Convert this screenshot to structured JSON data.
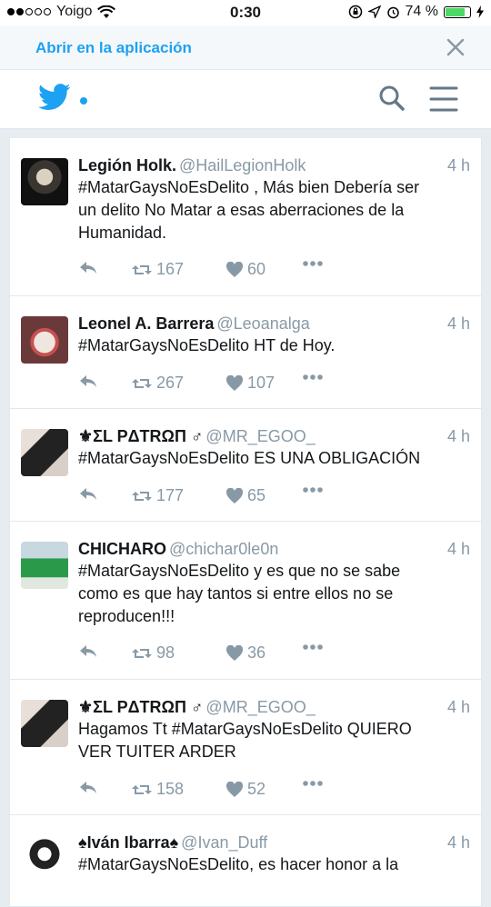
{
  "status_bar": {
    "carrier": "Yoigo",
    "time": "0:30",
    "battery": "74 %",
    "battery_level": 0.74
  },
  "banner": {
    "open_in_app": "Abrir en la aplicación"
  },
  "icons": {
    "logo": "twitter-bird-icon",
    "search": "search-icon",
    "menu": "hamburger-menu-icon",
    "close": "close-icon"
  },
  "colors": {
    "accent": "#1da1f2",
    "muted": "#8899a6",
    "background": "#e6ecf0",
    "border": "#e1e8ed"
  },
  "tweets": [
    {
      "name": "Legión Holk.",
      "handle": "@HailLegionHolk",
      "time": "4 h",
      "lines": [
        "#MatarGaysNoEsDelito , Más bien Debería ser",
        "un delito No Matar a esas aberraciones de la",
        "Humanidad."
      ],
      "retweets": "167",
      "likes": "60"
    },
    {
      "name": "Leonel A. Barrera",
      "handle": "@Leoanalga",
      "time": "4 h",
      "lines": [
        "#MatarGaysNoEsDelito HT de Hoy."
      ],
      "retweets": "267",
      "likes": "107"
    },
    {
      "name": "⚜ΣL PΔTRΩП ♂",
      "handle": "@MR_EGOO_",
      "time": "4 h",
      "lines": [
        "#MatarGaysNoEsDelito ES UNA OBLIGACIÓN"
      ],
      "retweets": "177",
      "likes": "65"
    },
    {
      "name": "CHICHARO",
      "handle": "@chichar0le0n",
      "time": "4 h",
      "lines": [
        "#MatarGaysNoEsDelito y es que no se sabe",
        "como es que hay tantos si entre ellos no se",
        "reproducen!!!"
      ],
      "retweets": "98",
      "likes": "36"
    },
    {
      "name": "⚜ΣL PΔTRΩП ♂",
      "handle": "@MR_EGOO_",
      "time": "4 h",
      "lines": [
        "Hagamos Tt #MatarGaysNoEsDelito QUIERO",
        "VER TUITER ARDER"
      ],
      "retweets": "158",
      "likes": "52"
    },
    {
      "name": "♠Iván Ibarra♠",
      "handle": "@Ivan_Duff",
      "time": "4 h",
      "lines": [
        "#MatarGaysNoEsDelito, es hacer honor a la"
      ],
      "retweets": "",
      "likes": ""
    }
  ]
}
